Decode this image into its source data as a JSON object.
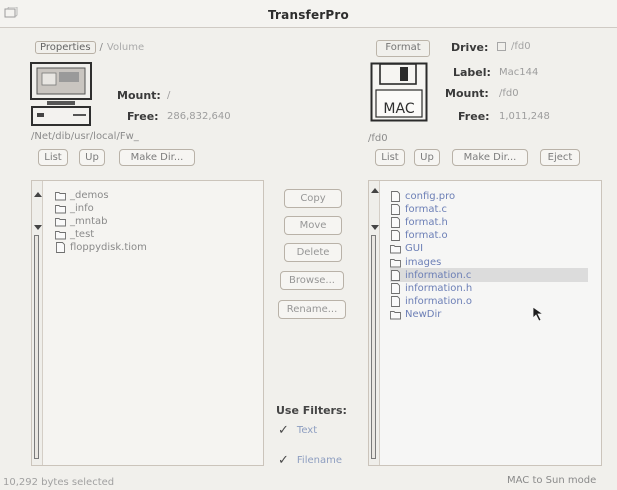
{
  "window": {
    "title": "TransferPro"
  },
  "tabs": {
    "properties": "Properties",
    "separator": "/",
    "inactive": "Volume"
  },
  "left": {
    "mount_label": "Mount:",
    "mount_value": "/",
    "free_label": "Free:",
    "free_value": "286,832,640",
    "path": "/Net/dib/usr/local/Fw_",
    "buttons": {
      "list": "List",
      "up": "Up",
      "make_dir": "Make Dir..."
    },
    "files": [
      {
        "name": "_demos",
        "icon": "folder-icon"
      },
      {
        "name": "_info",
        "icon": "folder-icon"
      },
      {
        "name": "_mntab",
        "icon": "folder-icon"
      },
      {
        "name": "_test",
        "icon": "folder-icon"
      },
      {
        "name": "floppydisk.tiom",
        "icon": "document-icon"
      }
    ]
  },
  "right": {
    "format_button": "Format",
    "drive_label": "Drive:",
    "drive_value": "/fd0",
    "disk_label": "MAC",
    "label_label": "Label:",
    "label_value": "Mac144",
    "mount_label": "Mount:",
    "mount_value": "/fd0",
    "free_label": "Free:",
    "free_value": "1,011,248",
    "path": "/fd0",
    "buttons": {
      "list": "List",
      "up": "Up",
      "make_dir": "Make Dir...",
      "eject": "Eject"
    },
    "files": [
      {
        "name": "config.pro",
        "icon": "document-icon"
      },
      {
        "name": "format.c",
        "icon": "document-icon"
      },
      {
        "name": "format.h",
        "icon": "document-icon"
      },
      {
        "name": "format.o",
        "icon": "document-icon"
      },
      {
        "name": "GUI",
        "icon": "folder-icon"
      },
      {
        "name": "images",
        "icon": "folder-icon"
      },
      {
        "name": "information.c",
        "icon": "document-icon"
      },
      {
        "name": "information.h",
        "icon": "document-icon"
      },
      {
        "name": "information.o",
        "icon": "document-icon"
      },
      {
        "name": "NewDir",
        "icon": "folder-icon"
      }
    ]
  },
  "actions": {
    "copy": "Copy",
    "move": "Move",
    "delete": "Delete",
    "browse": "Browse...",
    "rename": "Rename..."
  },
  "filters": {
    "label": "Use Filters:",
    "text_label": "Text",
    "text_checked": true,
    "filename_label": "Filename",
    "filename_checked": true
  },
  "status": {
    "selection": "10,292 bytes selected",
    "mode": "MAC to Sun mode"
  }
}
